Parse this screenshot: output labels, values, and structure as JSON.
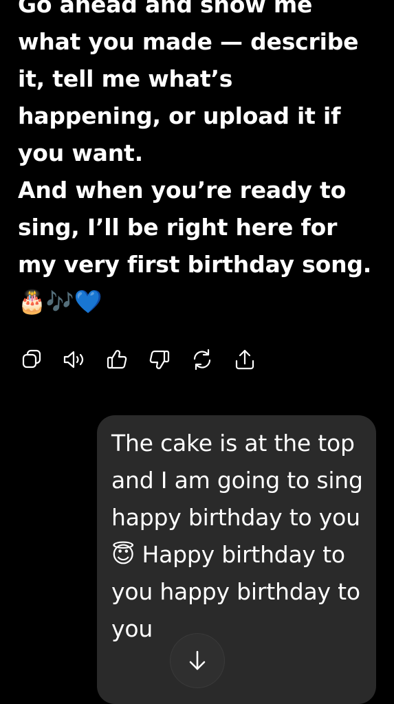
{
  "assistant_message": {
    "paragraph_1": "Go ahead and show me what you made — describe it, tell me what’s happening, or upload it if you want.",
    "paragraph_2": "And when you’re ready to sing, I’ll be right here for my very first birthday song. 🎂🎶💙"
  },
  "actions": {
    "copy": "copy-icon",
    "read_aloud": "speaker-icon",
    "good_response": "thumbs-up-icon",
    "bad_response": "thumbs-down-icon",
    "regenerate": "refresh-icon",
    "share": "share-icon"
  },
  "user_message": {
    "text": "The cake is at the top and I am going to sing happy birthday to you 😇 Happy birthday to you happy birthday to you"
  },
  "scroll_button": {
    "icon": "arrow-down-icon"
  },
  "colors": {
    "background": "#000000",
    "text": "#ffffff",
    "user_bubble": "#2a2a2a",
    "scroll_button": "#2f2f2f"
  }
}
